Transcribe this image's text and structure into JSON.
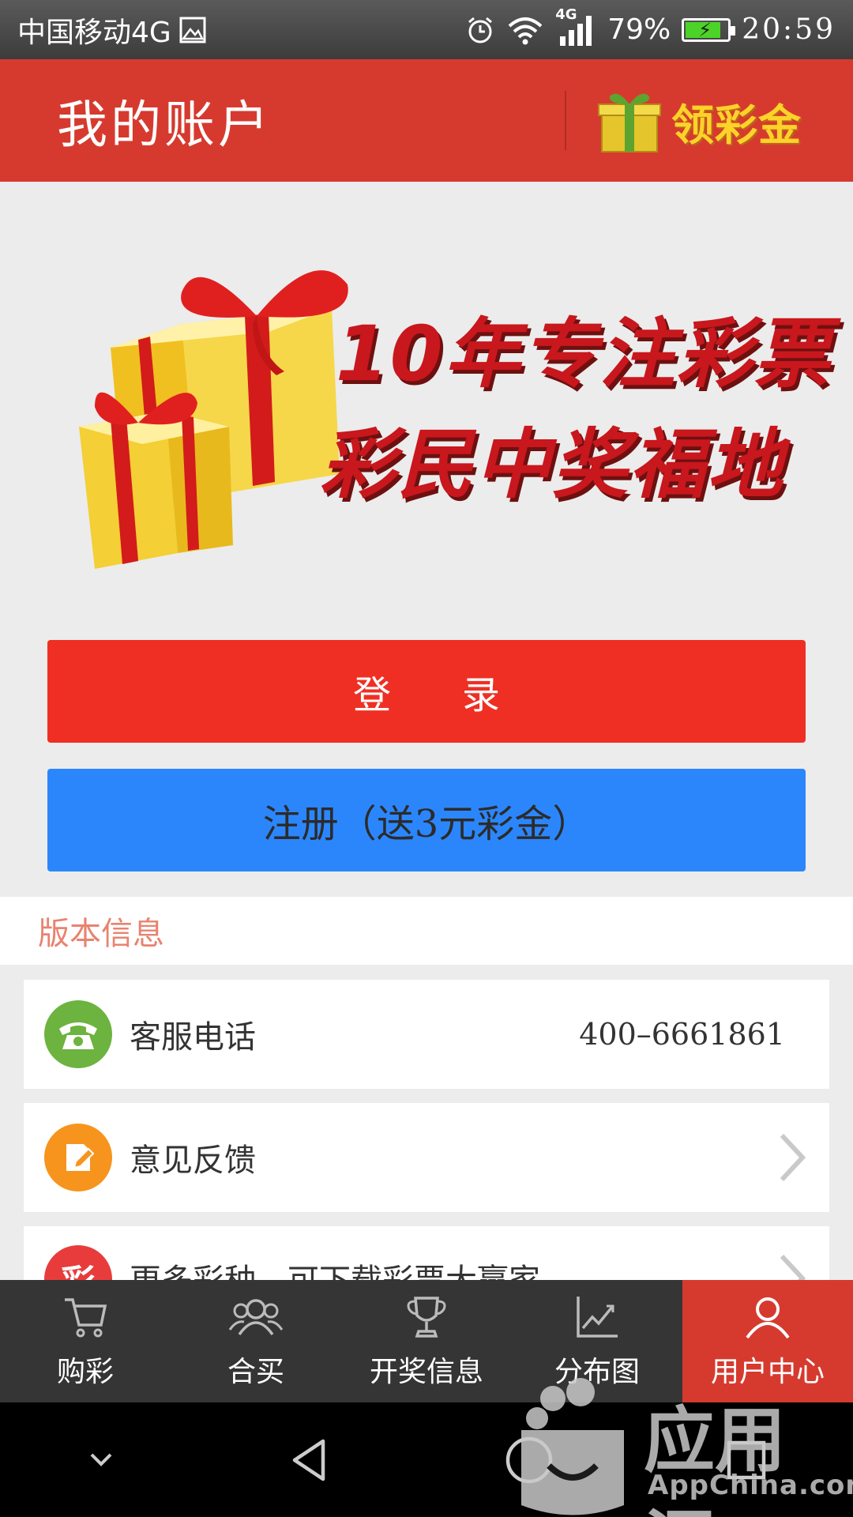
{
  "status_bar": {
    "carrier": "中国移动4G",
    "network": "4G",
    "battery": "79%",
    "battery_level": 0.79,
    "time": "20:59",
    "icons": [
      "image-icon",
      "alarm-icon",
      "wifi-icon",
      "signal-icon",
      "battery-icon"
    ]
  },
  "header": {
    "title": "我的账户",
    "bonus_label": "领彩金"
  },
  "banner": {
    "line1": "10年专注彩票",
    "line2": "彩民中奖福地"
  },
  "buttons": {
    "login": "登录",
    "register": "注册（送3元彩金）"
  },
  "colors": {
    "header_red": "#d63a2f",
    "login_red": "#ef2f23",
    "register_blue": "#2c86fb",
    "section_title": "#e8836f",
    "phone_icon_green": "#6db33f",
    "feedback_icon_orange": "#f7941d",
    "more_icon_red": "#e83c3c",
    "tabbar_bg": "#353535"
  },
  "section": {
    "title": "版本信息"
  },
  "rows": [
    {
      "label": "客服电话",
      "value": "400–6661861",
      "icon": "phone-icon"
    },
    {
      "label": "意见反馈",
      "icon": "feedback-icon"
    },
    {
      "label": "更多彩种，可下载彩票大赢家",
      "icon": "lottery-icon",
      "icon_text": "彩"
    }
  ],
  "tabs": [
    {
      "label": "购彩",
      "icon": "cart-icon"
    },
    {
      "label": "合买",
      "icon": "group-icon"
    },
    {
      "label": "开奖信息",
      "icon": "trophy-icon"
    },
    {
      "label": "分布图",
      "icon": "chart-icon"
    },
    {
      "label": "用户中心",
      "icon": "user-icon",
      "active": true
    }
  ],
  "watermark": {
    "text": "应用汇",
    "sub": "AppChina.com"
  }
}
